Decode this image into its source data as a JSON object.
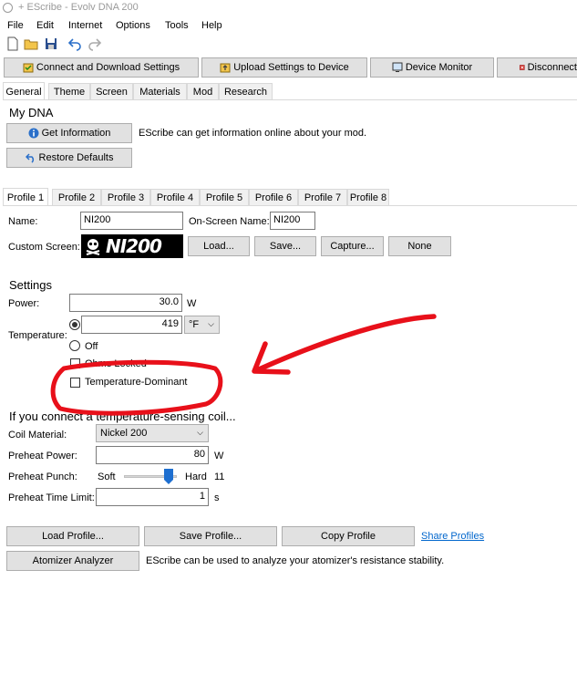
{
  "window": {
    "title": "+ EScribe - Evolv DNA 200"
  },
  "menu": [
    "File",
    "Edit",
    "Internet",
    "Options",
    "Tools",
    "Help"
  ],
  "toolbar": {
    "connect_label": "Connect and Download Settings",
    "upload_label": "Upload Settings to Device",
    "monitor_label": "Device Monitor",
    "disconnect_label": "Disconnect"
  },
  "main_tabs": [
    "General",
    "Theme",
    "Screen",
    "Materials",
    "Mod",
    "Research"
  ],
  "my_dna": {
    "heading": "My DNA",
    "get_info_label": "Get Information",
    "get_info_desc": "EScribe can get information online about your mod.",
    "restore_label": "Restore Defaults"
  },
  "profile_tabs": [
    "Profile 1",
    "Profile 2",
    "Profile 3",
    "Profile 4",
    "Profile 5",
    "Profile 6",
    "Profile 7",
    "Profile 8"
  ],
  "profile": {
    "name_label": "Name:",
    "name_value": "NI200",
    "onscreen_label": "On-Screen Name:",
    "onscreen_value": "NI200",
    "custom_screen_label": "Custom Screen:",
    "custom_screen_text": "NI200",
    "load_label": "Load...",
    "save_label": "Save...",
    "capture_label": "Capture...",
    "none_label": "None"
  },
  "settings": {
    "heading": "Settings",
    "power_label": "Power:",
    "power_value": "30.0",
    "power_unit": "W",
    "temp_label": "Temperature:",
    "temp_value": "419",
    "temp_unit": "°F",
    "off_label": "Off",
    "ohms_locked_label": "Ohms Locked",
    "temp_dominant_label": "Temperature-Dominant"
  },
  "coil": {
    "heading": "If you connect a temperature-sensing coil...",
    "material_label": "Coil Material:",
    "material_value": "Nickel 200",
    "preheat_power_label": "Preheat Power:",
    "preheat_power_value": "80",
    "preheat_power_unit": "W",
    "preheat_punch_label": "Preheat Punch:",
    "punch_soft": "Soft",
    "punch_hard": "Hard",
    "punch_value": "11",
    "punch_level_fraction": 0.92,
    "preheat_time_label": "Preheat Time Limit:",
    "preheat_time_value": "1",
    "preheat_time_unit": "s"
  },
  "actions": {
    "load_profile": "Load Profile...",
    "save_profile": "Save Profile...",
    "copy_profile": "Copy Profile",
    "share_profiles": "Share Profiles",
    "atomizer_analyzer": "Atomizer Analyzer",
    "atomizer_desc": "EScribe can be used to analyze your atomizer's resistance stability."
  },
  "colors": {
    "annotation_red": "#e8101a",
    "link_blue": "#0066cc",
    "slider_thumb": "#1e6fd0"
  }
}
